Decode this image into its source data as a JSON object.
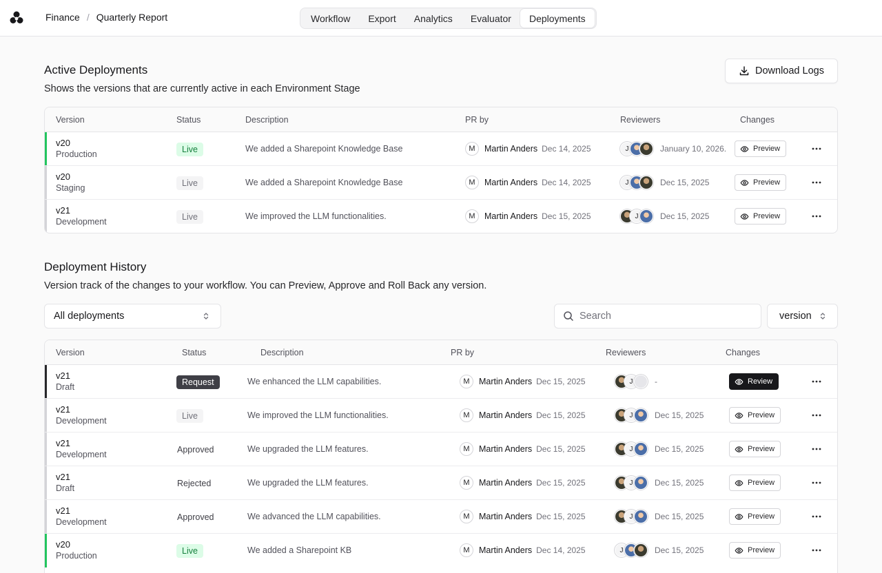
{
  "header": {
    "breadcrumb": [
      "Finance",
      "Quarterly Report"
    ],
    "tabs": [
      "Workflow",
      "Export",
      "Analytics",
      "Evaluator",
      "Deployments"
    ],
    "active_tab": "Deployments"
  },
  "active": {
    "title": "Active Deployments",
    "subtitle": "Shows the versions that are currently active in each Environment Stage",
    "download_label": "Download Logs",
    "columns": [
      "Version",
      "Status",
      "Description",
      "PR by",
      "Reviewers",
      "Changes"
    ],
    "rows": [
      {
        "version": "v20",
        "env": "Production",
        "status": "Live",
        "desc": "We added a Sharepoint Knowledge Base",
        "pr_initial": "M",
        "pr_name": "Martin Anders",
        "pr_date": "Dec 14, 2025",
        "rev_date": "January 10, 2026.",
        "action": "Preview"
      },
      {
        "version": "v20",
        "env": "Staging",
        "status": "Live",
        "desc": "We added a Sharepoint Knowledge Base",
        "pr_initial": "M",
        "pr_name": "Martin Anders",
        "pr_date": "Dec 14, 2025",
        "rev_date": "Dec 15, 2025",
        "action": "Preview"
      },
      {
        "version": "v21",
        "env": "Development",
        "status": "Live",
        "desc": "We improved the LLM functionalities.",
        "pr_initial": "M",
        "pr_name": "Martin Anders",
        "pr_date": "Dec 15, 2025",
        "rev_date": "Dec 15, 2025",
        "action": "Preview"
      }
    ]
  },
  "history": {
    "title": "Deployment History",
    "subtitle": "Version track of the changes to your workflow. You can Preview, Approve and Roll Back any version.",
    "filter_value": "All deployments",
    "search_placeholder": "Search",
    "sort_value": "version",
    "columns": [
      "Version",
      "Status",
      "Description",
      "PR by",
      "Reviewers",
      "Changes"
    ],
    "rows": [
      {
        "version": "v21",
        "env": "Draft",
        "status": "Request",
        "desc": "We enhanced the LLM capabilities.",
        "pr_initial": "M",
        "pr_name": "Martin Anders",
        "pr_date": "Dec 15, 2025",
        "rev_date": "-",
        "action": "Review"
      },
      {
        "version": "v21",
        "env": "Development",
        "status": "Live",
        "desc": "We improved the LLM functionalities.",
        "pr_initial": "M",
        "pr_name": "Martin Anders",
        "pr_date": "Dec 15, 2025",
        "rev_date": "Dec 15, 2025",
        "action": "Preview"
      },
      {
        "version": "v21",
        "env": "Development",
        "status": "Approved",
        "desc": "We upgraded the LLM features.",
        "pr_initial": "M",
        "pr_name": "Martin Anders",
        "pr_date": "Dec 15, 2025",
        "rev_date": "Dec 15, 2025",
        "action": "Preview"
      },
      {
        "version": "v21",
        "env": "Draft",
        "status": "Rejected",
        "desc": "We upgraded the LLM features.",
        "pr_initial": "M",
        "pr_name": "Martin Anders",
        "pr_date": "Dec 15, 2025",
        "rev_date": "Dec 15, 2025",
        "action": "Preview"
      },
      {
        "version": "v21",
        "env": "Development",
        "status": "Approved",
        "desc": "We advanced the LLM capabilities.",
        "pr_initial": "M",
        "pr_name": "Martin Anders",
        "pr_date": "Dec 15, 2025",
        "rev_date": "Dec 15, 2025",
        "action": "Preview"
      },
      {
        "version": "v20",
        "env": "Production",
        "status": "Live",
        "desc": "We added a Sharepoint KB",
        "pr_initial": "M",
        "pr_name": "Martin Anders",
        "pr_date": "Dec 14, 2025",
        "rev_date": "Dec 15, 2025",
        "action": "Preview"
      }
    ]
  },
  "reviewer_initial": "J",
  "colors": {
    "live_green": "#22c55e",
    "live_bg": "#dcfce7",
    "request_bg": "#3f3f46"
  }
}
